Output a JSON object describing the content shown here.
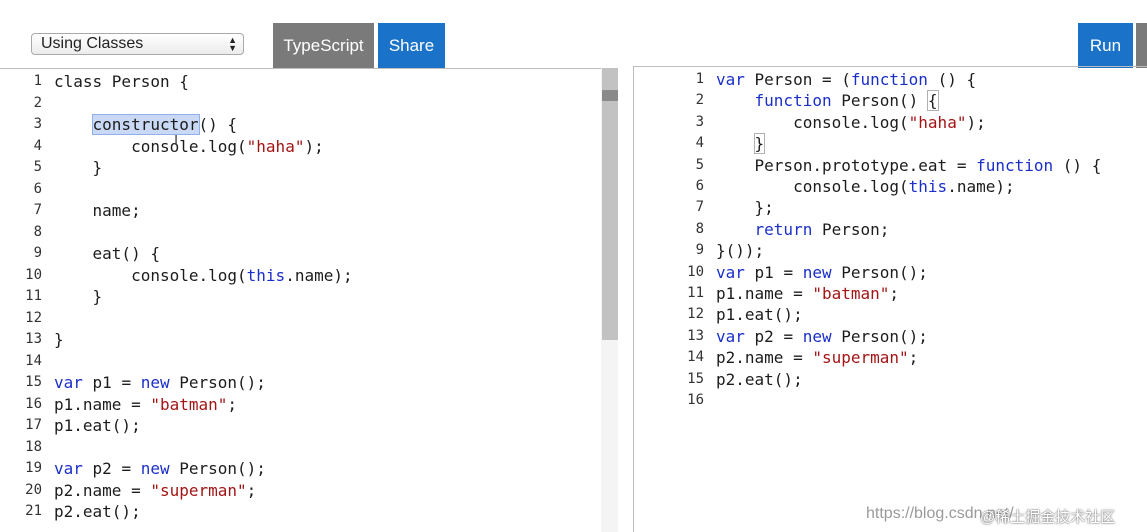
{
  "toolbar": {
    "select_value": "Using Classes",
    "typescript_label": "TypeScript",
    "share_label": "Share",
    "run_label": "Run"
  },
  "editor": {
    "lines": [
      [
        {
          "t": "class Person {"
        }
      ],
      [],
      [
        {
          "t": "    "
        },
        {
          "t": "constructor",
          "c": "sel"
        },
        {
          "t": "() {"
        }
      ],
      [
        {
          "t": "        console.log("
        },
        {
          "t": "\"haha\"",
          "c": "str"
        },
        {
          "t": ");"
        }
      ],
      [
        {
          "t": "    }"
        }
      ],
      [],
      [
        {
          "t": "    name;"
        }
      ],
      [],
      [
        {
          "t": "    eat() {"
        }
      ],
      [
        {
          "t": "        console.log("
        },
        {
          "t": "this",
          "c": "kw"
        },
        {
          "t": ".name);"
        }
      ],
      [
        {
          "t": "    }"
        }
      ],
      [],
      [
        {
          "t": "}"
        }
      ],
      [],
      [
        {
          "t": "var",
          "c": "kw"
        },
        {
          "t": " p1 = "
        },
        {
          "t": "new",
          "c": "kw"
        },
        {
          "t": " Person();"
        }
      ],
      [
        {
          "t": "p1.name = "
        },
        {
          "t": "\"batman\"",
          "c": "str"
        },
        {
          "t": ";"
        }
      ],
      [
        {
          "t": "p1.eat();"
        }
      ],
      [],
      [
        {
          "t": "var",
          "c": "kw"
        },
        {
          "t": " p2 = "
        },
        {
          "t": "new",
          "c": "kw"
        },
        {
          "t": " Person();"
        }
      ],
      [
        {
          "t": "p2.name = "
        },
        {
          "t": "\"superman\"",
          "c": "str"
        },
        {
          "t": ";"
        }
      ],
      [
        {
          "t": "p2.eat();"
        }
      ]
    ]
  },
  "output": {
    "lines": [
      [
        {
          "t": "var",
          "c": "kw"
        },
        {
          "t": " Person = ("
        },
        {
          "t": "function",
          "c": "kw"
        },
        {
          "t": " () {"
        }
      ],
      [
        {
          "t": "    "
        },
        {
          "t": "function",
          "c": "kw"
        },
        {
          "t": " Person() "
        },
        {
          "t": "{",
          "c": "bracket"
        }
      ],
      [
        {
          "t": "        console.log("
        },
        {
          "t": "\"haha\"",
          "c": "str"
        },
        {
          "t": ");"
        }
      ],
      [
        {
          "t": "    "
        },
        {
          "t": "}",
          "c": "bracket"
        }
      ],
      [
        {
          "t": "    Person.prototype.eat = "
        },
        {
          "t": "function",
          "c": "kw"
        },
        {
          "t": " () {"
        }
      ],
      [
        {
          "t": "        console.log("
        },
        {
          "t": "this",
          "c": "kw"
        },
        {
          "t": ".name);"
        }
      ],
      [
        {
          "t": "    };"
        }
      ],
      [
        {
          "t": "    "
        },
        {
          "t": "return",
          "c": "kw"
        },
        {
          "t": " Person;"
        }
      ],
      [
        {
          "t": "}());"
        }
      ],
      [
        {
          "t": "var",
          "c": "kw"
        },
        {
          "t": " p1 = "
        },
        {
          "t": "new",
          "c": "kw"
        },
        {
          "t": " Person();"
        }
      ],
      [
        {
          "t": "p1.name = "
        },
        {
          "t": "\"batman\"",
          "c": "str"
        },
        {
          "t": ";"
        }
      ],
      [
        {
          "t": "p1.eat();"
        }
      ],
      [
        {
          "t": "var",
          "c": "kw"
        },
        {
          "t": " p2 = "
        },
        {
          "t": "new",
          "c": "kw"
        },
        {
          "t": " Person();"
        }
      ],
      [
        {
          "t": "p2.name = "
        },
        {
          "t": "\"superman\"",
          "c": "str"
        },
        {
          "t": ";"
        }
      ],
      [
        {
          "t": "p2.eat();"
        }
      ],
      []
    ]
  },
  "watermark": {
    "url_text": "https://blog.csdn.net/",
    "site_text": "@稀土掘金技术社区"
  },
  "colors": {
    "keyword": "#1a2fc9",
    "string": "#a31515",
    "button_blue": "#1a73c8",
    "button_gray": "#7a7a7a"
  }
}
